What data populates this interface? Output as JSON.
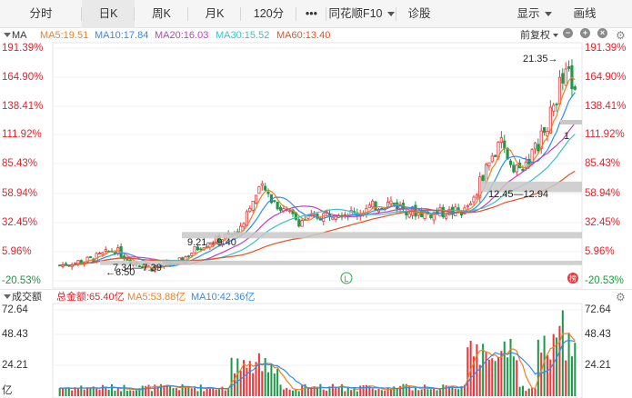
{
  "tabs": [
    {
      "label": "分时",
      "active": false
    },
    {
      "label": "日K",
      "active": true
    },
    {
      "label": "周K",
      "active": false
    },
    {
      "label": "月K",
      "active": false
    },
    {
      "label": "120分",
      "active": false
    },
    {
      "label": "•••",
      "active": false
    },
    {
      "label": "同花顺F10",
      "active": false,
      "dropdown": true
    },
    {
      "label": "诊股",
      "active": false
    },
    {
      "label": "显示",
      "active": false,
      "dropdown": true
    },
    {
      "label": "画线",
      "active": false
    }
  ],
  "ma_bar": {
    "title": "MA",
    "ma5": "MA5:19.51",
    "ma10": "MA10:17.84",
    "ma20": "MA20:16.03",
    "ma30": "MA30:15.52",
    "ma60": "MA60:13.40",
    "adjust_label": "前复权"
  },
  "vol_bar": {
    "title": "成交额",
    "total": "总金额:65.40亿",
    "ma5": "MA5:53.88亿",
    "ma10": "MA10:42.36亿"
  },
  "colors": {
    "up": "#e8383d",
    "down": "#1c9a4a",
    "ma5": "#f08020",
    "ma10": "#2d8cf0",
    "ma20": "#c040c0",
    "ma30": "#3cc0c8",
    "ma60": "#e85020",
    "axis_up": "#e0242e",
    "axis_down": "#1a9a3c"
  },
  "icons": {
    "collapse": "triangle-down-icon",
    "minus": "zoom-out-icon",
    "plus": "zoom-in-icon",
    "close": "close-icon",
    "settings": "gear-icon",
    "label_L": "L-marker-icon",
    "label_bang": "榜-marker-icon"
  },
  "price_axis": {
    "left": [
      "191.39%",
      "164.90%",
      "138.41%",
      "111.92%",
      "85.43%",
      "58.94%",
      "32.45%",
      "5.96%",
      "-20.53%"
    ],
    "right": [
      "191.39%",
      "164.90%",
      "138.41%",
      "111.92%",
      "85.43%",
      "58.94%",
      "32.45%",
      "5.96%",
      "-20.53%"
    ]
  },
  "vol_axis": {
    "left": [
      "72.64",
      "48.43",
      "24.21",
      "亿"
    ],
    "right": [
      "72.64",
      "48.43",
      "24.21"
    ]
  },
  "annotations": {
    "high": "21.35→",
    "zone1": "12.45—12.94",
    "zone2": "9.21—9.40",
    "zone3": "7.34—7.39",
    "low": "←6.50",
    "right_mark": "1",
    "L": "L",
    "bang": "榜"
  },
  "chart_data": {
    "type": "candlestick",
    "y_range_pct": [
      -20.53,
      191.39
    ],
    "vol_range": [
      0,
      72.64
    ],
    "high_value": 21.35,
    "low_value": 6.5,
    "support_zones": [
      [
        12.45,
        12.94
      ],
      [
        9.21,
        9.4
      ],
      [
        7.34,
        7.39
      ]
    ],
    "ma_values": {
      "MA5": 19.51,
      "MA10": 17.84,
      "MA20": 16.03,
      "MA30": 15.52,
      "MA60": 13.4
    },
    "total_amount_yi": 65.4,
    "vol_ma": {
      "MA5": 53.88,
      "MA10": 42.36
    }
  }
}
